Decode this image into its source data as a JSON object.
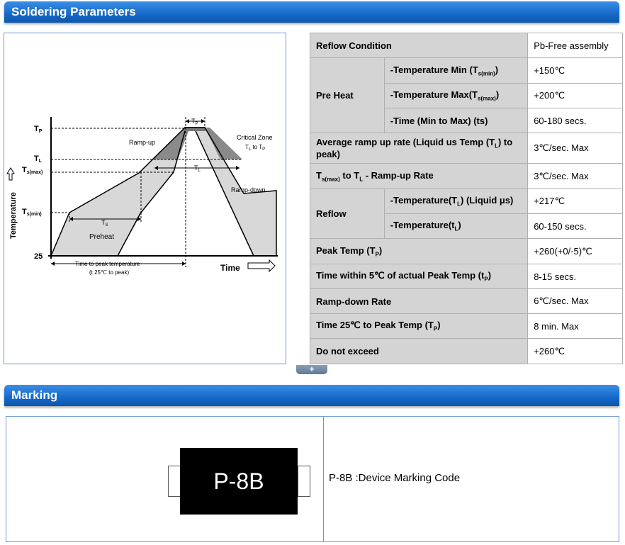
{
  "sections": {
    "soldering_title": "Soldering Parameters",
    "marking_title": "Marking"
  },
  "diagram": {
    "tp": "T",
    "tp_sub": "P",
    "tl": "T",
    "tl_sub": "L",
    "tsmax": "T",
    "tsmax_sub": "s(max)",
    "tsmin": "T",
    "tsmin_sub": "s(min)",
    "t25": "25",
    "tp_time": "T",
    "tp_time_sub": "P",
    "tl_time": "T",
    "tl_time_sub": "L",
    "ts_time": "T",
    "ts_time_sub": "S",
    "ramp_up": "Ramp-up",
    "ramp_down": "Ramp-down",
    "preheat": "Preheat",
    "critical_zone": "Critical Zone",
    "critical_zone_sub": "T",
    "critical_zone_to": " to T",
    "temperature_axis": "Temperature",
    "time_axis": "Time",
    "time_to_peak_1": "Time to peak temperature",
    "time_to_peak_2": "(t 25℃ to peak)"
  },
  "table": {
    "reflow_condition": "Reflow Condition",
    "pb_free": "Pb-Free assembly",
    "pre_heat": "Pre Heat",
    "temp_min": "-Temperature Min (T",
    "temp_min_sub": "s(min)",
    "temp_min_val": "+150℃",
    "temp_max": "-Temperature Max(T",
    "temp_max_sub": "s(max)",
    "temp_max_val": "+200℃",
    "time_min_max": "-Time (Min to Max) (ts)",
    "time_min_max_val": "60-180 secs.",
    "avg_ramp": "Average ramp up rate (Liquid us Temp (T",
    "avg_ramp_sub": "L",
    "avg_ramp_tail": ") to peak)",
    "avg_ramp_val": "3℃/sec. Max",
    "ts_to_tl": "T",
    "ts_to_tl_sub": "s(max)",
    "ts_to_tl_mid": " to T",
    "ts_to_tl_sub2": "L",
    "ts_to_tl_tail": " - Ramp-up Rate",
    "ts_to_tl_val": "3℃/sec. Max",
    "reflow": "Reflow",
    "reflow_temp": "-Temperature(T",
    "reflow_temp_sub": "L",
    "reflow_temp_tail": ") (Liquid μs)",
    "reflow_temp_val": "+217℃",
    "reflow_time": "-Temperature(t",
    "reflow_time_sub": "L",
    "reflow_time_tail": ")",
    "reflow_time_val": "60-150 secs.",
    "peak_temp": "Peak Temp (T",
    "peak_temp_sub": "P",
    "peak_temp_tail": ")",
    "peak_temp_val": "+260(+0/-5)℃",
    "time_within": "Time within 5℃ of actual Peak Temp (t",
    "time_within_sub": "P",
    "time_within_tail": ")",
    "time_within_val": "8-15 secs.",
    "ramp_down": "Ramp-down Rate",
    "ramp_down_val": "6℃/sec. Max",
    "time_25": "Time 25℃ to Peak Temp (T",
    "time_25_sub": "P",
    "time_25_tail": ")",
    "time_25_val": "8 min. Max",
    "do_not_exceed": "Do not exceed",
    "do_not_exceed_val": "+260℃"
  },
  "expand_label": "+",
  "marking": {
    "chip_label": "P-8B",
    "description": "P-8B :Device Marking Code"
  }
}
